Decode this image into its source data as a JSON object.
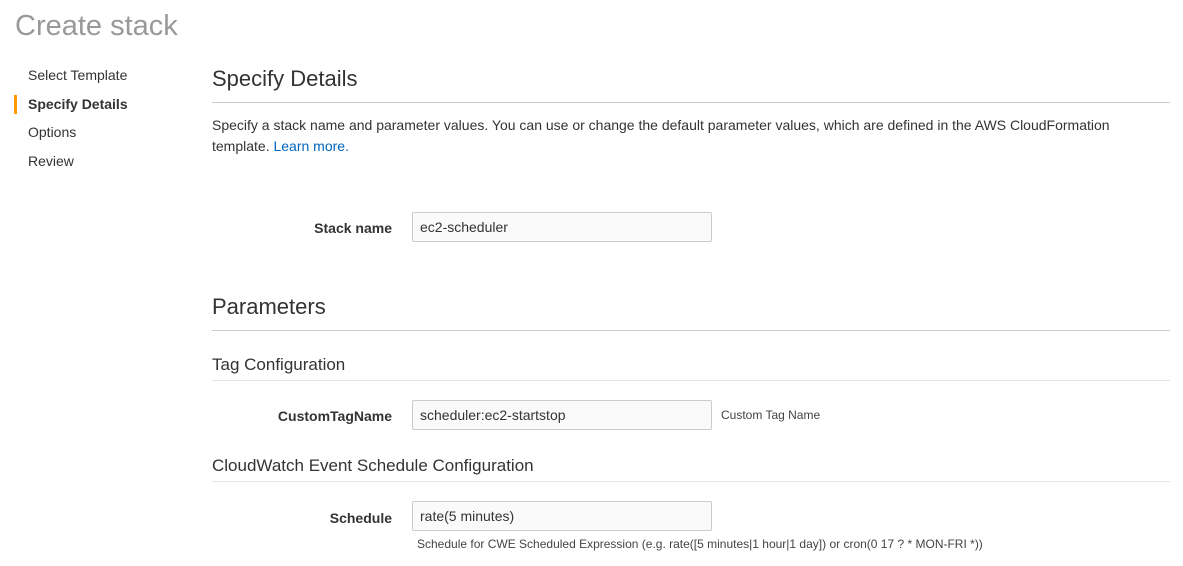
{
  "title": "Create stack",
  "nav": [
    "Select Template",
    "Specify Details",
    "Options",
    "Review"
  ],
  "section": {
    "title": "Specify Details",
    "desc": "Specify a stack name and parameter values. You can use or change the default parameter values, which are defined in the AWS CloudFormation template.",
    "learn_more": "Learn more."
  },
  "stack_name": {
    "label": "Stack name",
    "value": "ec2-scheduler"
  },
  "parameters": {
    "title": "Parameters",
    "tag_group": "Tag Configuration",
    "tag_label": "CustomTagName",
    "tag_value": "scheduler:ec2-startstop",
    "tag_hint": "Custom Tag Name",
    "cwe_group": "CloudWatch Event Schedule Configuration",
    "schedule_label": "Schedule",
    "schedule_value": "rate(5 minutes)",
    "schedule_hint": "Schedule for CWE Scheduled Expression (e.g. rate([5 minutes|1 hour|1 day]) or cron(0 17 ? * MON-FRI *))"
  }
}
